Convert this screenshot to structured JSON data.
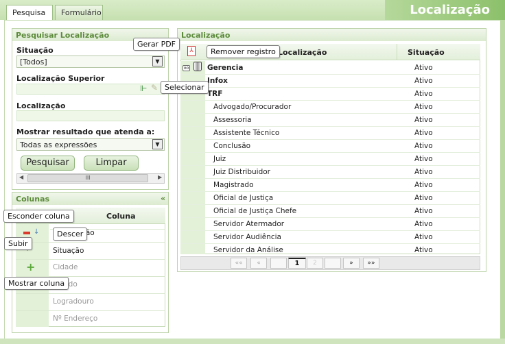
{
  "header": {
    "title": "Localização",
    "tabs": [
      {
        "label": "Pesquisa"
      },
      {
        "label": "Formulário"
      }
    ]
  },
  "search": {
    "panel_title": "Pesquisar Localização",
    "situacao_label": "Situação",
    "situacao_value": "[Todos]",
    "loc_superior_label": "Localização Superior",
    "loc_label": "Localização",
    "mostrar_label": "Mostrar resultado que atenda a:",
    "mostrar_value": "Todas as expressões",
    "search_button": "Pesquisar",
    "clear_button": "Limpar",
    "scroll_thumb": "III"
  },
  "columns": {
    "panel_title": "Colunas",
    "collapse": "«",
    "header": "Coluna",
    "rows": [
      {
        "label": "Localização",
        "visible": true
      },
      {
        "label": "Situação",
        "visible": true
      },
      {
        "label": "Cidade",
        "visible": false
      },
      {
        "label": "Estado",
        "visible": false
      },
      {
        "label": "Logradouro",
        "visible": false
      },
      {
        "label": "Nº Endereço",
        "visible": false
      }
    ]
  },
  "grid": {
    "panel_title": "Localização",
    "col_name": "Localização",
    "col_situacao": "Situação",
    "rows": [
      {
        "name": "Gerencia",
        "situacao": "Ativo",
        "level": 0
      },
      {
        "name": "Infox",
        "situacao": "Ativo",
        "level": 0
      },
      {
        "name": "TRF",
        "situacao": "Ativo",
        "level": 0
      },
      {
        "name": "Advogado/Procurador",
        "situacao": "Ativo",
        "level": 1
      },
      {
        "name": "Assessoria",
        "situacao": "Ativo",
        "level": 1
      },
      {
        "name": "Assistente Técnico",
        "situacao": "Ativo",
        "level": 1
      },
      {
        "name": "Conclusão",
        "situacao": "Ativo",
        "level": 1
      },
      {
        "name": "Juiz",
        "situacao": "Ativo",
        "level": 1
      },
      {
        "name": "Juiz Distribuidor",
        "situacao": "Ativo",
        "level": 1
      },
      {
        "name": "Magistrado",
        "situacao": "Ativo",
        "level": 1
      },
      {
        "name": "Oficial de Justiça",
        "situacao": "Ativo",
        "level": 1
      },
      {
        "name": "Oficial de Justiça Chefe",
        "situacao": "Ativo",
        "level": 1
      },
      {
        "name": "Servidor Atermador",
        "situacao": "Ativo",
        "level": 1
      },
      {
        "name": "Servidor Audiência",
        "situacao": "Ativo",
        "level": 1
      },
      {
        "name": "Servidor da Análise",
        "situacao": "Ativo",
        "level": 1
      }
    ],
    "pager": {
      "first": "««",
      "prev": "«",
      "current": "1",
      "next_page": "2",
      "next": "»",
      "last": "»»"
    }
  },
  "tooltips": {
    "gerar_pdf": "Gerar PDF",
    "remover": "Remover registro",
    "selecionar": "Selecionar",
    "esconder": "Esconder coluna",
    "descer": "Descer",
    "subir": "Subir",
    "mostrar": "Mostrar coluna"
  },
  "colors": {
    "accent": "#5b8a3a",
    "header_green": "#8cc06a"
  }
}
